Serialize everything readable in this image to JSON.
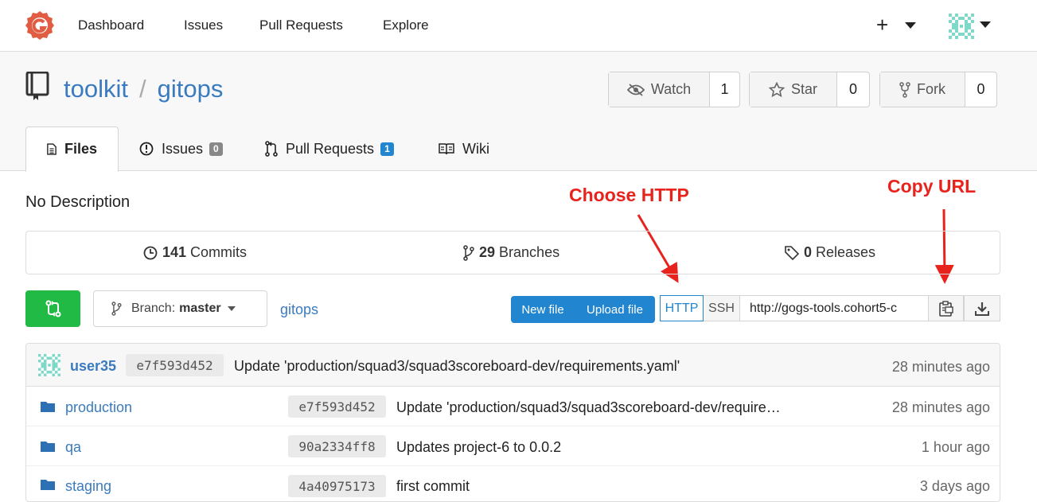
{
  "nav": {
    "items": [
      "Dashboard",
      "Issues",
      "Pull Requests",
      "Explore"
    ],
    "plus": "+"
  },
  "repo": {
    "owner": "toolkit",
    "separator": "/",
    "name": "gitops",
    "watch_label": "Watch",
    "watch_count": "1",
    "star_label": "Star",
    "star_count": "0",
    "fork_label": "Fork",
    "fork_count": "0"
  },
  "tabs": [
    {
      "label": "Files"
    },
    {
      "label": "Issues",
      "badge": "0"
    },
    {
      "label": "Pull Requests",
      "badge": "1"
    },
    {
      "label": "Wiki"
    }
  ],
  "description": "No Description",
  "annotations": {
    "choose_http": "Choose HTTP",
    "copy_url": "Copy URL"
  },
  "stats": {
    "commits_num": "141",
    "commits_label": "Commits",
    "branches_num": "29",
    "branches_label": "Branches",
    "releases_num": "0",
    "releases_label": "Releases"
  },
  "toolbar": {
    "branch_prefix": "Branch:",
    "branch_name": "master",
    "breadcrumb": "gitops",
    "new_file": "New file",
    "upload_file": "Upload file",
    "http": "HTTP",
    "ssh": "SSH",
    "clone_url": "http://gogs-tools.cohort5-c"
  },
  "latest_commit": {
    "user": "user35",
    "sha": "e7f593d452",
    "message": "Update 'production/squad3/squad3scoreboard-dev/requirements.yaml'",
    "time": "28 minutes ago"
  },
  "files": [
    {
      "name": "production",
      "sha": "e7f593d452",
      "message": "Update 'production/squad3/squad3scoreboard-dev/require…",
      "time": "28 minutes ago"
    },
    {
      "name": "qa",
      "sha": "90a2334ff8",
      "message": "Updates project-6 to 0.0.2",
      "time": "1 hour ago"
    },
    {
      "name": "staging",
      "sha": "4a40975173",
      "message": "first commit",
      "time": "3 days ago"
    }
  ],
  "colors": {
    "link": "#3a7bbf",
    "primary": "#2185d0",
    "green": "#21ba45",
    "annotation": "#e8231d",
    "logo": "#e05d44"
  }
}
